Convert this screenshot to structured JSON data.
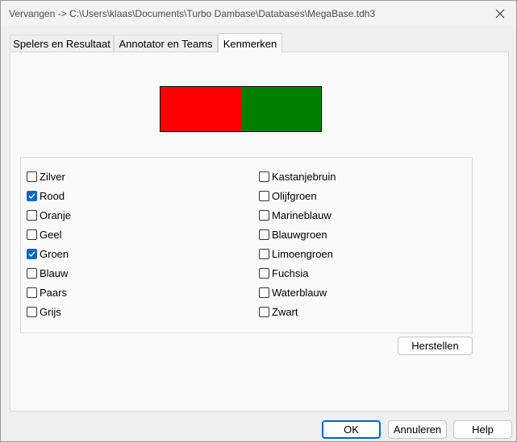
{
  "window": {
    "title": "Vervangen -> C:\\Users\\klaas\\Documents\\Turbo Dambase\\Databases\\MegaBase.tdh3",
    "close_icon": "close-icon"
  },
  "tabs": [
    {
      "label": "Spelers en Resultaat",
      "active": false
    },
    {
      "label": "Annotator en Teams",
      "active": false
    },
    {
      "label": "Kenmerken",
      "active": true
    }
  ],
  "swatch": {
    "colors": [
      "#ff0000",
      "#008000"
    ]
  },
  "colors_left": [
    {
      "label": "Zilver",
      "checked": false
    },
    {
      "label": "Rood",
      "checked": true
    },
    {
      "label": "Oranje",
      "checked": false
    },
    {
      "label": "Geel",
      "checked": false
    },
    {
      "label": "Groen",
      "checked": true
    },
    {
      "label": "Blauw",
      "checked": false
    },
    {
      "label": "Paars",
      "checked": false
    },
    {
      "label": "Grijs",
      "checked": false
    }
  ],
  "colors_right": [
    {
      "label": "Kastanjebruin",
      "checked": false
    },
    {
      "label": "Olijfgroen",
      "checked": false
    },
    {
      "label": "Marineblauw",
      "checked": false
    },
    {
      "label": "Blauwgroen",
      "checked": false
    },
    {
      "label": "Limoengroen",
      "checked": false
    },
    {
      "label": "Fuchsia",
      "checked": false
    },
    {
      "label": "Waterblauw",
      "checked": false
    },
    {
      "label": "Zwart",
      "checked": false
    }
  ],
  "buttons": {
    "reset": "Herstellen",
    "ok": "OK",
    "cancel": "Annuleren",
    "help": "Help"
  }
}
